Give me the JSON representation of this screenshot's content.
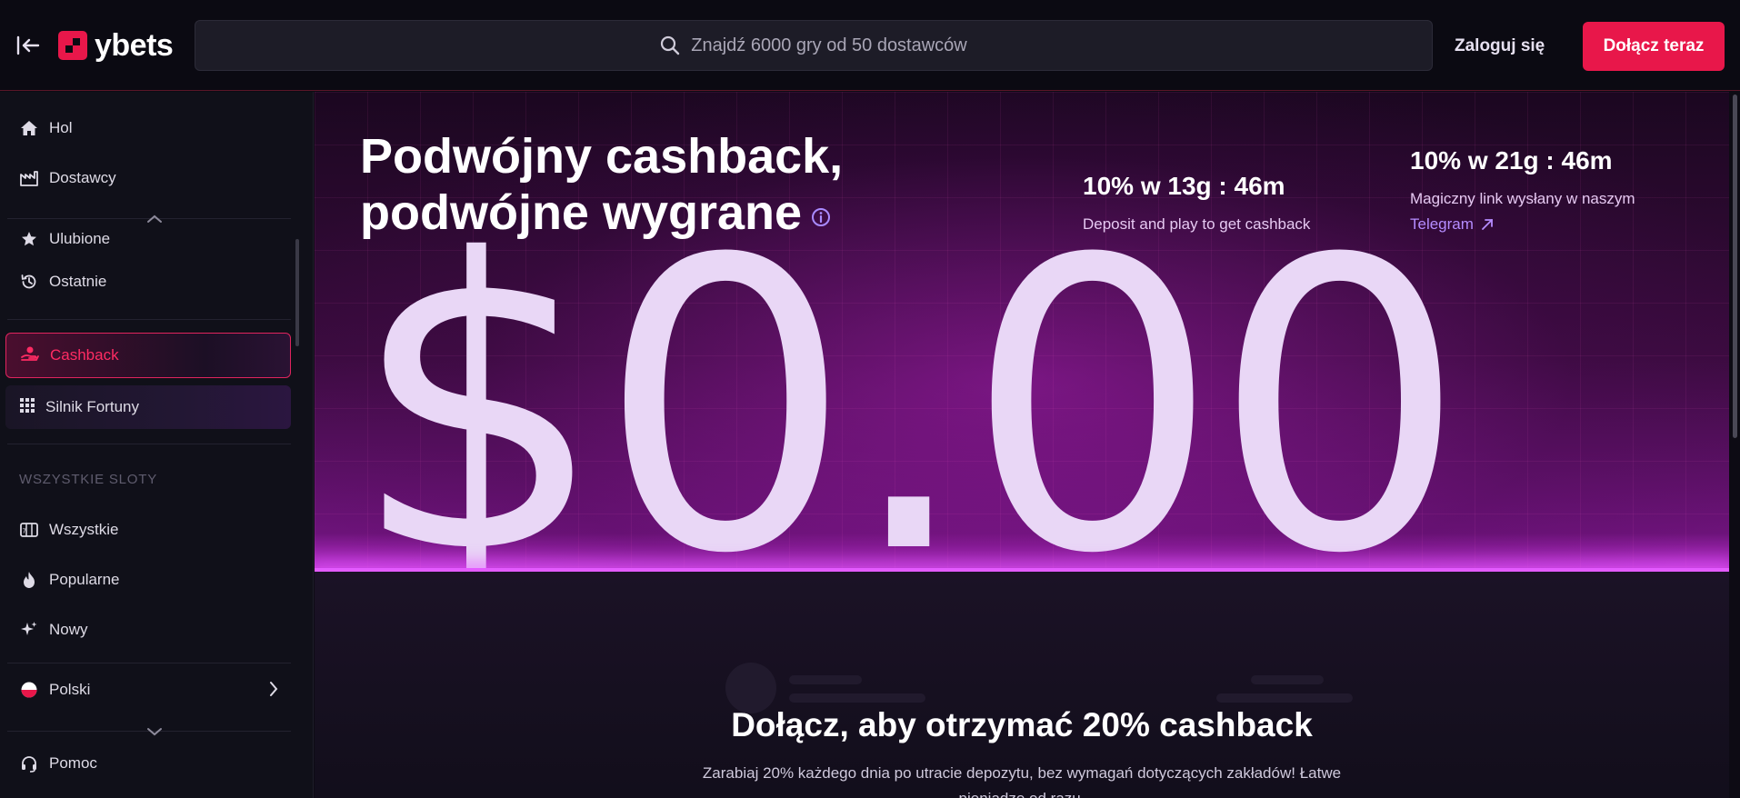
{
  "header": {
    "logo_text": "ybets",
    "search_placeholder": "Znajdź 6000 gry od 50 dostawców",
    "login_label": "Zaloguj się",
    "join_label": "Dołącz teraz"
  },
  "sidebar": {
    "items": [
      {
        "label": "Hol",
        "icon": "home-icon"
      },
      {
        "label": "Dostawcy",
        "icon": "providers-icon"
      },
      {
        "label": "Ulubione",
        "icon": "favorites-icon"
      },
      {
        "label": "Ostatnie",
        "icon": "history-icon"
      }
    ],
    "cashback_label": "Cashback",
    "fortune_label": "Silnik Fortuny",
    "section_title": "WSZYSTKIE SLOTY",
    "slots": [
      {
        "label": "Wszystkie",
        "icon": "slot-machine-icon"
      },
      {
        "label": "Popularne",
        "icon": "fire-icon"
      },
      {
        "label": "Nowy",
        "icon": "sparkle-icon"
      }
    ],
    "language_label": "Polski",
    "help_label": "Pomoc"
  },
  "hero": {
    "title_line1": "Podwójny cashback,",
    "title_line2": "podwójne wygrane",
    "timer1_value": "10% w 13g : 46m",
    "timer1_sub": "Deposit and play to get cashback",
    "timer2_value": "10% w 21g : 46m",
    "timer2_sub": "Magiczny link wysłany w naszym",
    "timer2_link": "Telegram",
    "amount": "$0.00"
  },
  "join_section": {
    "heading": "Dołącz, aby otrzymać 20% cashback",
    "text": "Zarabiaj 20% każdego dnia po utracie depozytu, bez wymagań dotyczących zakładów! Łatwe pieniądze od razu."
  },
  "colors": {
    "accent": "#e8174a",
    "cashback_red": "#ff2b63",
    "link_purple": "#b58cff"
  }
}
